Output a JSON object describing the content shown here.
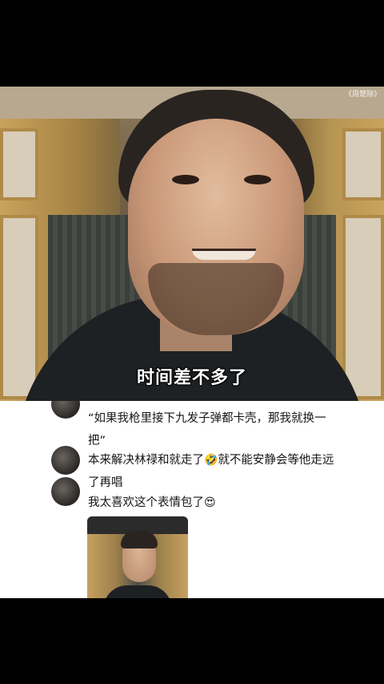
{
  "video": {
    "watermark": "《周楚除》",
    "subtitle": "时间差不多了"
  },
  "comments": [
    {
      "text": "“如果我枪里接下九发子弹都卡壳，那我就换一把”",
      "emoji": ""
    },
    {
      "text_before": "本来解决林禄和就走了",
      "emoji": "🤣",
      "text_after": "就不能安静会等他走远了再唱"
    },
    {
      "text_before": "我太喜欢这个表情包了",
      "emoji": "😍",
      "text_after": ""
    }
  ],
  "thumbnail": {
    "icon": "video-thumbnail"
  }
}
